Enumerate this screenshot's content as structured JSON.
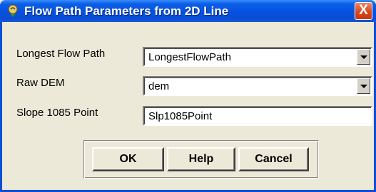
{
  "window": {
    "title": "Flow Path Parameters from 2D Line",
    "close_label": "X",
    "accent_color": "#0A4FD6"
  },
  "fields": {
    "longest_flow_path": {
      "label": "Longest Flow Path",
      "value": "LongestFlowPath",
      "type": "dropdown"
    },
    "raw_dem": {
      "label": "Raw DEM",
      "value": "dem",
      "type": "dropdown"
    },
    "slope_1085_point": {
      "label": "Slope 1085 Point",
      "value": "Slp1085Point",
      "type": "text"
    }
  },
  "buttons": {
    "ok": "OK",
    "help": "Help",
    "cancel": "Cancel"
  },
  "icons": {
    "app": "arcgis-hydro-icon",
    "close": "close-icon",
    "dropdown": "chevron-down-icon"
  }
}
